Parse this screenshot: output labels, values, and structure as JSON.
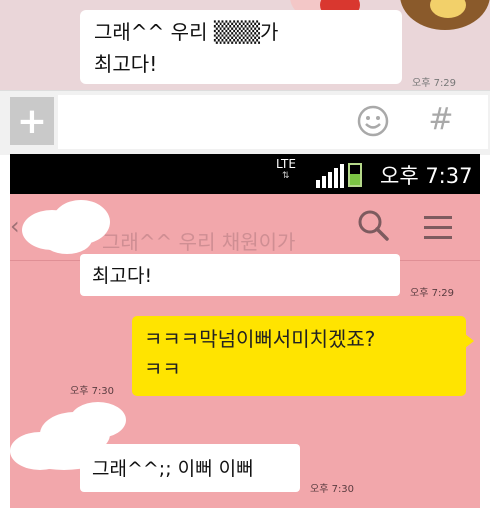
{
  "top_chat": {
    "message": "그래^^ 우리 ▒▒▒가\n최고다!",
    "time": "오후 7:29"
  },
  "input_bar": {
    "plus_label": "+",
    "hash_label": "#"
  },
  "status_bar": {
    "network": "LTE",
    "network_arrows": "⇅",
    "time": "오후 7:37"
  },
  "chat_header": {
    "back_label": "‹",
    "title": "그래^^ 우리 채원이가"
  },
  "messages": [
    {
      "text": "최고다!",
      "time": "오후 7:29"
    },
    {
      "text": "ㅋㅋㅋ막넘이뻐서미치겠죠?\nㅋㅋ",
      "time": "오후 7:30",
      "sent": true
    },
    {
      "text": "그래^^;; 이뻐 이뻐",
      "time": "오후 7:30"
    }
  ],
  "colors": {
    "chat_background": "#f2a7ab",
    "sent_bubble": "#ffe400",
    "received_bubble": "#ffffff",
    "status_bar": "#000000"
  }
}
